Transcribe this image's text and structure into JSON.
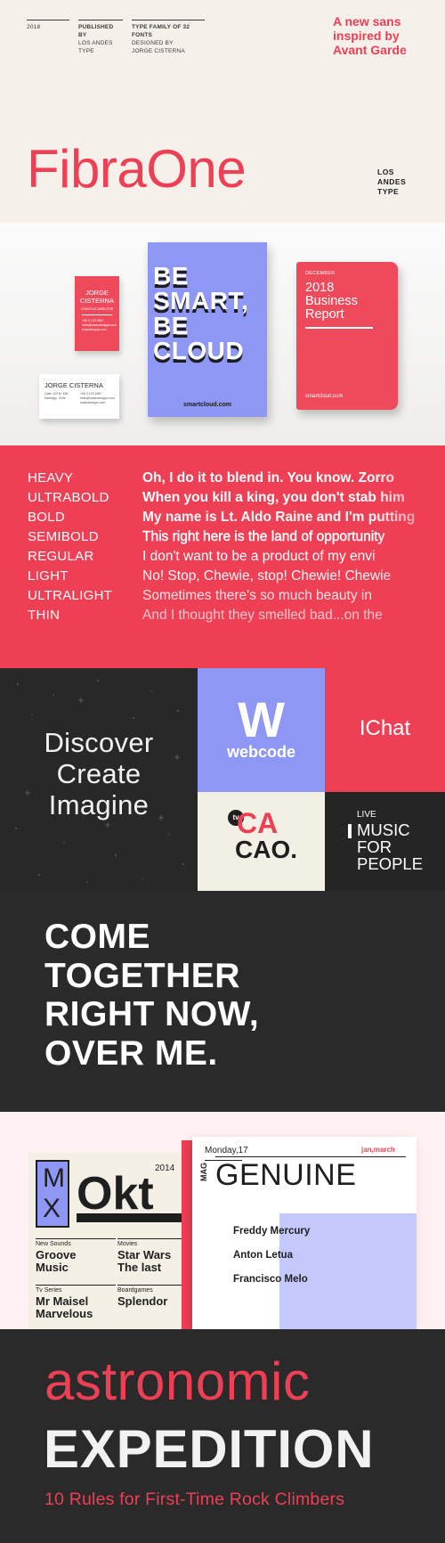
{
  "header": {
    "year": "2018",
    "published_label": "PUBLISHED BY",
    "published_value": "LOS ANDES TYPE",
    "family_label": "TYPE FAMILY OF 32 FONTS",
    "designed_label": "DESIGNED BY",
    "designer": "JORGE CISTERNA",
    "tagline": "A new sans inspired by Avant Garde",
    "title": "FibraOne",
    "foundry": [
      "LOS",
      "ANDES",
      "TYPE"
    ],
    "accent_color": "#ef3f55"
  },
  "mockups": {
    "card_red": {
      "name_line1": "JORGE",
      "name_line2": "CISTERNA",
      "role": "CREATIVE DIRECTOR",
      "contacts": [
        "+56 9 123 4567",
        "hello@losandestype.com",
        "losandestype.com"
      ]
    },
    "card_white": {
      "name": "JORGE CISTERNA",
      "address": [
        "Calle 123 Nº 456",
        "Santiago, Chile"
      ],
      "contacts": [
        "+56 9 123 4567",
        "hello@losandestype.com",
        "losandestype.com"
      ]
    },
    "poster": {
      "lines": [
        "BE",
        "SMART,",
        "BE",
        "CLOUD"
      ],
      "footer": "smartcloud.com",
      "color": "#8e97f4"
    },
    "report": {
      "month": "DECEMBER",
      "title_lines": [
        "2018",
        "Business",
        "Report"
      ],
      "footer": "smartcloud.com"
    }
  },
  "weights": {
    "rows": [
      {
        "name": "HEAVY",
        "sample": "Oh, I do it to blend in. You know. Zorro"
      },
      {
        "name": "ULTRABOLD",
        "sample": "When you kill a king, you don't stab him"
      },
      {
        "name": "BOLD",
        "sample": "My name is Lt. Aldo Raine and I'm putting"
      },
      {
        "name": "SEMIBOLD",
        "sample": "This right here is the land of opportunity"
      },
      {
        "name": "REGULAR",
        "sample": "I don't want to be a product of my envi"
      },
      {
        "name": "LIGHT",
        "sample": "No! Stop, Chewie, stop! Chewie! Chewie"
      },
      {
        "name": "ULTRALIGHT",
        "sample": "Sometimes there's so much beauty in"
      },
      {
        "name": "THIN",
        "sample": "And I thought they smelled bad...on the"
      }
    ]
  },
  "discover": {
    "lines": [
      "Discover",
      "Create",
      "Imagine"
    ],
    "webcode_mark": "W",
    "webcode_label": "webcode",
    "ichat": "IChat",
    "cacao_tv": "tv",
    "cacao_line1": "CA",
    "cacao_line2": "CAO.",
    "music_live": "LIVE",
    "music_lines": [
      "MUSIC",
      "FOR",
      "PEOPLE"
    ]
  },
  "come": {
    "lines": [
      "COME",
      "TOGETHER",
      "RIGHT NOW,",
      "OVER ME."
    ]
  },
  "magazine": {
    "mx_letters": [
      "M",
      "X"
    ],
    "okt": "Okt",
    "year": "2014",
    "cells": [
      {
        "label": "New Sounds",
        "value_lines": [
          "Groove",
          "Music"
        ]
      },
      {
        "label": "Movies",
        "value_lines": [
          "Star Wars",
          "The last"
        ]
      },
      {
        "label": "Tv Series",
        "value_lines": [
          "Mr Maisel",
          "Marvelous"
        ]
      },
      {
        "label": "Boardgames",
        "value_lines": [
          "Splendor"
        ]
      }
    ],
    "date": "Monday,17",
    "issue": "jan,march",
    "vertical": "MAG",
    "title": "GENUINE",
    "names": [
      "Freddy Mercury",
      "Anton Letua",
      "Francisco Melo"
    ]
  },
  "astro": {
    "line1": "astronomic",
    "line2": "EXPEDITION",
    "subtitle": "10 Rules for First-Time Rock Climbers"
  }
}
